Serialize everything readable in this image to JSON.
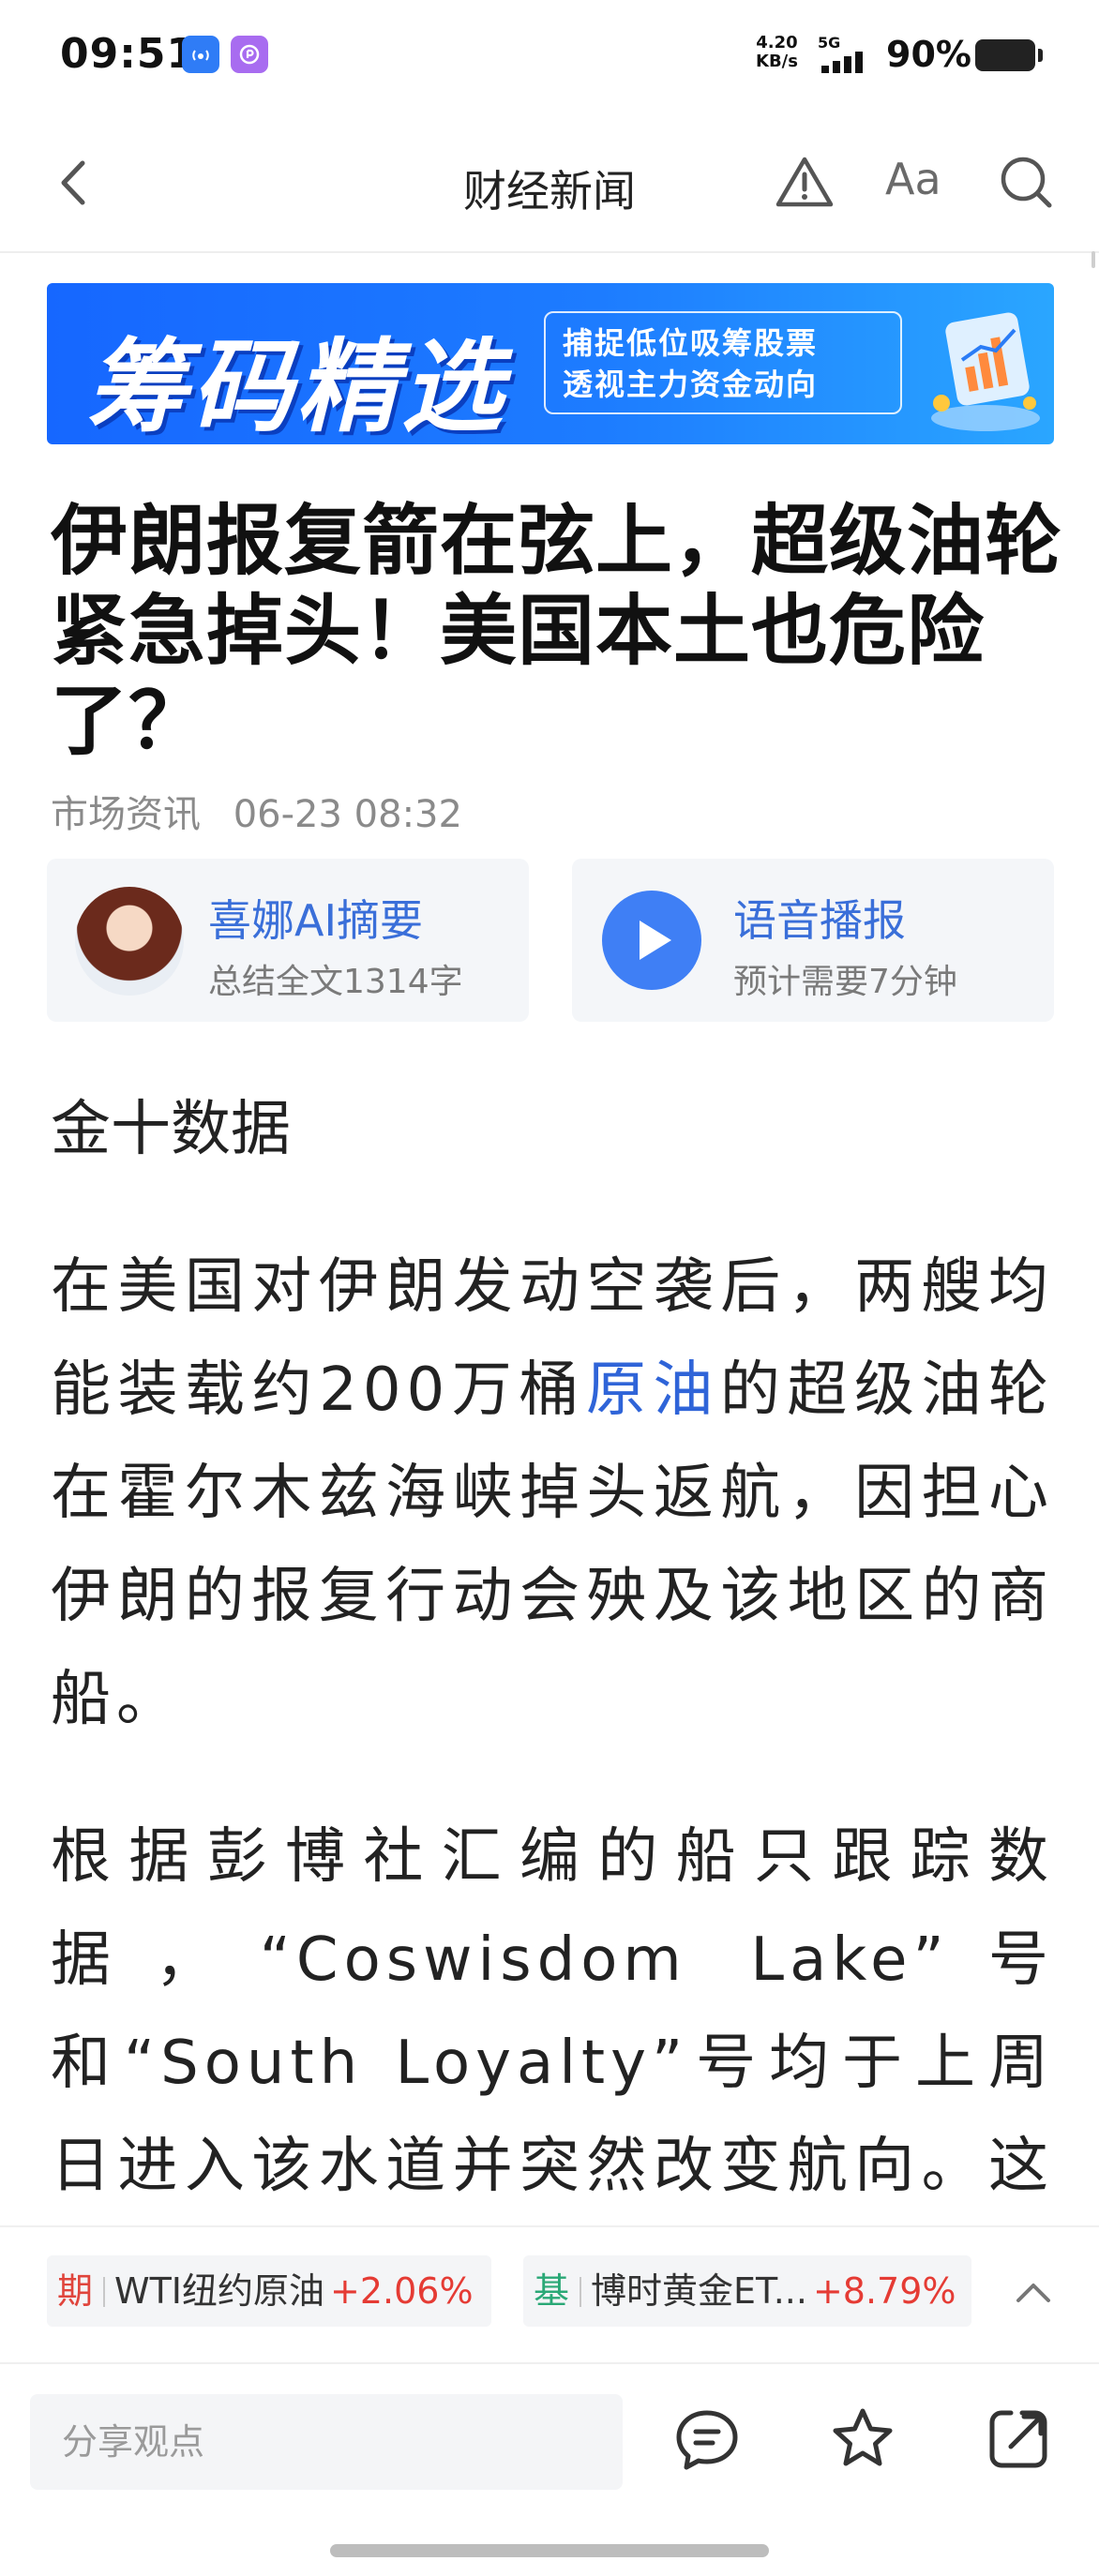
{
  "status": {
    "time": "09:51",
    "net_speed_value": "4.20",
    "net_speed_unit": "KB/s",
    "network": "5G",
    "battery": "90%"
  },
  "nav": {
    "title": "财经新闻",
    "font_button": "Aa",
    "icons": [
      "back-arrow-icon",
      "warning-icon",
      "font-size-icon",
      "search-icon"
    ]
  },
  "banner": {
    "title": "筹码精选",
    "line1": "捕捉低位吸筹股票",
    "line2": "透视主力资金动向"
  },
  "article": {
    "headline": "伊朗报复箭在弦上，超级油轮紧急掉头！美国本土也危险了？",
    "source": "市场资讯",
    "datetime": "06-23 08:32",
    "byline": "金十数据",
    "p1_before": "在美国对伊朗发动空袭后，两艘均能装载约200万桶",
    "p1_link": "原油",
    "p1_after": "的超级油轮在霍尔木兹海峡掉头返航，因担心伊朗的报复行动会殃及该地区的商船。",
    "p2": "根据彭博社汇编的船只跟踪数据，“Coswisdom Lake”号和“South Loyalty”号均于上周日进入该水道并突然改变航向。这两艘空"
  },
  "cards": {
    "summary_title": "喜娜AI摘要",
    "summary_sub": "总结全文1314字",
    "audio_title": "语音播报",
    "audio_sub": "预计需要7分钟"
  },
  "ticker": {
    "items": [
      {
        "tag": "期",
        "name": "WTI纽约原油",
        "change": "+2.06%"
      },
      {
        "tag": "基",
        "name": "博时黄金ET...",
        "change": "+8.79%"
      }
    ]
  },
  "bottom": {
    "comment_placeholder": "分享观点",
    "icons": [
      "comment-icon",
      "favorite-star-icon",
      "share-icon"
    ]
  },
  "colors": {
    "link": "#2f64d8",
    "banner": "#1667ff",
    "up": "#e53b34",
    "card_title": "#3a6fd9"
  }
}
